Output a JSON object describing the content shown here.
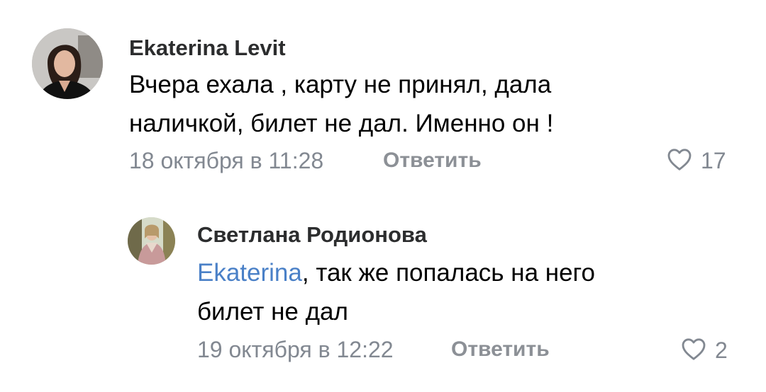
{
  "comments": [
    {
      "author": "Ekaterina Levit",
      "text_line1": "Вчера ехала , карту не принял, дала",
      "text_line2": "наличкой, билет не дал.  Именно он !",
      "date": "18 октября в 11:28",
      "reply_label": "Ответить",
      "likes": "17",
      "icons": {
        "avatar": "avatar-photo",
        "like": "heart-outline-icon"
      }
    },
    {
      "author": "Светлана Родионова",
      "mention": "Ekaterina",
      "text_line1_rest": ", так же попалась на него",
      "text_line2": "билет не дал",
      "date": "19 октября в 12:22",
      "reply_label": "Ответить",
      "likes": "2",
      "icons": {
        "avatar": "avatar-photo",
        "like": "heart-outline-icon"
      }
    }
  ],
  "colors": {
    "author": "#2c2d2e",
    "meta": "#828891",
    "mention": "#4a80c7"
  }
}
